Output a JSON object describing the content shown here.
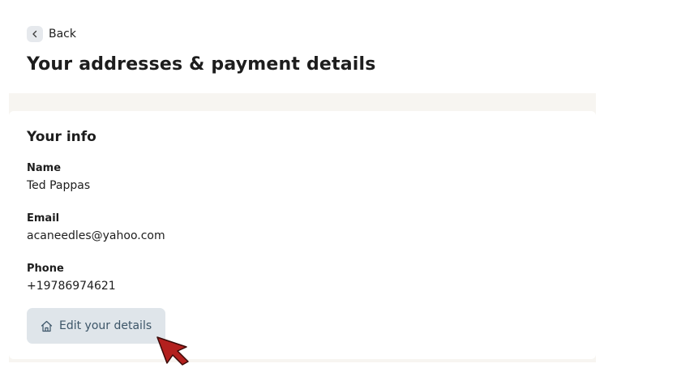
{
  "header": {
    "back_label": "Back",
    "title": "Your addresses & payment details"
  },
  "info": {
    "section_title": "Your info",
    "fields": [
      {
        "label": "Name",
        "value": "Ted Pappas"
      },
      {
        "label": "Email",
        "value": "acaneedles@yahoo.com"
      },
      {
        "label": "Phone",
        "value": "+19786974621"
      }
    ],
    "edit_button_label": "Edit your details",
    "edit_button_icon": "home-icon"
  },
  "colors": {
    "page_background": "#f7f5f1",
    "card_background": "#ffffff",
    "button_background": "#dfe5ea",
    "button_text": "#3c5568",
    "cursor": "#b3201e"
  }
}
